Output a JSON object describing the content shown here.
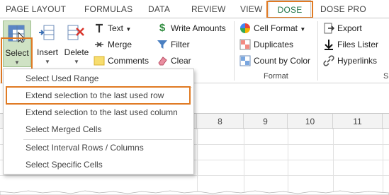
{
  "tabs": [
    "PAGE LAYOUT",
    "FORMULAS",
    "DATA",
    "REVIEW",
    "VIEW",
    "DOSE",
    "DOSE PRO"
  ],
  "active_tab": "DOSE",
  "accent_color": "#217346",
  "highlight_color": "#e07a23",
  "ribbon": {
    "select_label": "Select",
    "insert_label": "Insert",
    "delete_label": "Delete",
    "text_label": "Text",
    "merge_label": "Merge",
    "comments_label": "Comments",
    "write_amounts_label": "Write Amounts",
    "filter_label": "Filter",
    "clear_label": "Clear",
    "cell_format_label": "Cell Format",
    "duplicates_label": "Duplicates",
    "count_by_color_label": "Count by Color",
    "format_group_label": "Format",
    "export_label": "Export",
    "files_lister_label": "Files Lister",
    "hyperlinks_label": "Hyperlinks",
    "truncated_group_label": "S"
  },
  "columns": [
    "8",
    "9",
    "10",
    "11"
  ],
  "menu": {
    "items": [
      "Select Used Range",
      "Extend selection to the last used row",
      "Extend selection to the last used column",
      "Select Merged Cells",
      "Select Interval Rows / Columns",
      "Select Specific Cells"
    ],
    "highlighted": "Extend selection to the last used row"
  }
}
